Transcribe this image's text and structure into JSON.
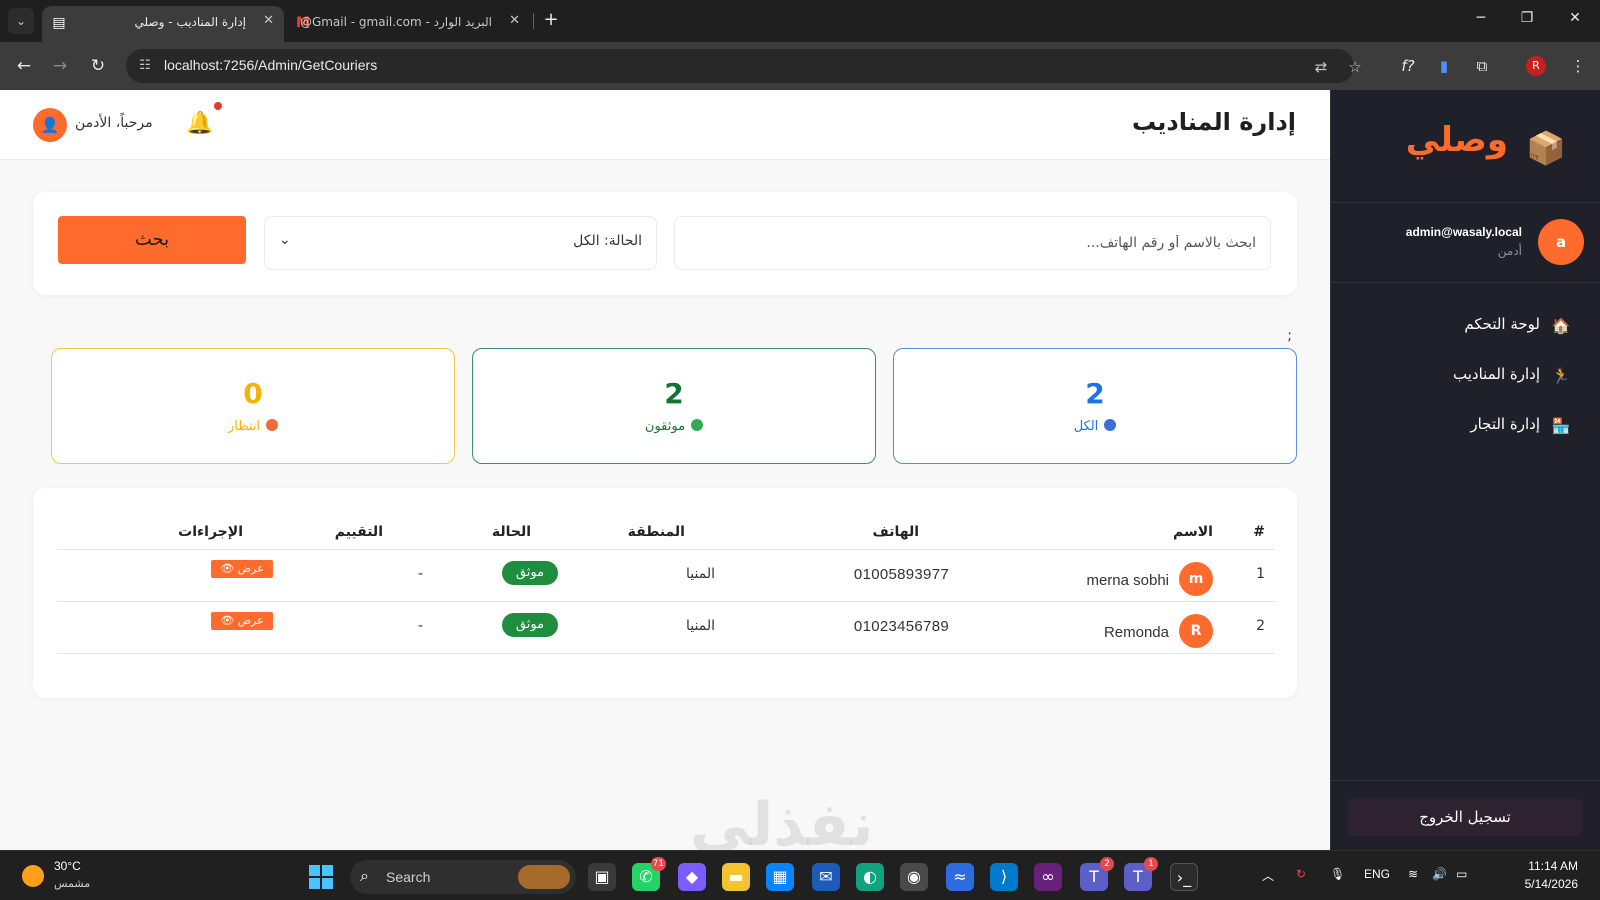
{
  "browser": {
    "tabs": [
      {
        "title": "إدارة المناديب - وصلي",
        "active": true,
        "favicon": "page-icon"
      },
      {
        "title": "البريد الوارد - Gmail - gmail.com@",
        "active": false,
        "favicon": "gmail-icon"
      }
    ],
    "url": "localhost:7256/Admin/GetCouriers",
    "profile_initial": "R"
  },
  "app": {
    "brand": "وصلي",
    "accent": "#ff6b2c",
    "user": {
      "avatar_initial": "a",
      "email": "admin@wasaly.local",
      "role": "أدمن"
    },
    "nav": [
      {
        "label": "لوحة التحكم",
        "icon": "home-icon"
      },
      {
        "label": "إدارة المناديب",
        "icon": "courier-icon"
      },
      {
        "label": "إدارة التجار",
        "icon": "store-icon"
      }
    ],
    "logout_label": "تسجيل الخروج",
    "page_title": "إدارة المناديب",
    "welcome": "مرحباً، الأدمن",
    "filters": {
      "search_placeholder": "ابحث بالاسم أو رقم الهاتف...",
      "status_value": "الحالة: الكل",
      "search_button": "بحث"
    },
    "stray_text": ";",
    "stats": [
      {
        "value": "2",
        "label": "الكل",
        "color": "#1a73e8",
        "border": "#5b8ed6",
        "dot": "#3b6fd4"
      },
      {
        "value": "2",
        "label": "موثقون",
        "color": "#137333",
        "border": "#3a8b7e",
        "dot": "#34a853"
      },
      {
        "value": "0",
        "label": "انتظار",
        "color": "#f5b301",
        "border": "#f1c84b",
        "dot": "#ef6c3a"
      }
    ],
    "table": {
      "headers": {
        "num": "#",
        "name": "الاسم",
        "phone": "الهاتف",
        "region": "المنطقة",
        "status": "الحالة",
        "rating": "التقييم",
        "actions": "الإجراءات"
      },
      "rows": [
        {
          "num": "1",
          "initial": "m",
          "name": "merna sobhi",
          "phone": "01005893977",
          "region": "المنيا",
          "status": "موثق",
          "rating": "-",
          "action": "عرض 👁"
        },
        {
          "num": "2",
          "initial": "R",
          "name": "Remonda",
          "phone": "01023456789",
          "region": "المنيا",
          "status": "موثق",
          "rating": "-",
          "action": "عرض 👁"
        }
      ]
    },
    "watermark": "نفذلي"
  },
  "taskbar": {
    "weather_temp": "30°C",
    "weather_cond": "مشمس",
    "search_label": "Search",
    "badges": {
      "whatsapp": "71",
      "teams1": "2",
      "teams2": "1"
    },
    "lang": "ENG",
    "time": "11:14 AM",
    "date": "5/14/2026"
  }
}
